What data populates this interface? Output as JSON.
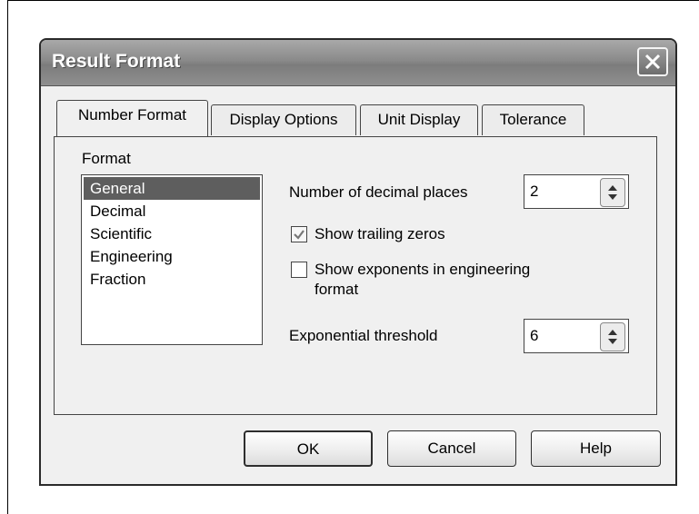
{
  "dialog": {
    "title": "Result Format",
    "close_icon": "close-icon"
  },
  "tabs": [
    {
      "label": "Number Format",
      "active": true
    },
    {
      "label": "Display Options",
      "active": false
    },
    {
      "label": "Unit Display",
      "active": false
    },
    {
      "label": "Tolerance",
      "active": false
    }
  ],
  "format": {
    "label": "Format",
    "items": [
      "General",
      "Decimal",
      "Scientific",
      "Engineering",
      "Fraction"
    ],
    "selected": "General"
  },
  "decimal_places": {
    "label": "Number of decimal places",
    "value": "2"
  },
  "show_trailing_zeros": {
    "label": "Show trailing zeros",
    "checked": true
  },
  "show_exponents": {
    "label_line1": "Show exponents in engineering",
    "label_line2": "format",
    "checked": false
  },
  "exponential_threshold": {
    "label": "Exponential threshold",
    "value": "6"
  },
  "buttons": {
    "ok": "OK",
    "cancel": "Cancel",
    "help": "Help"
  },
  "colors": {
    "title_bar": "#8a8a8a",
    "selected_item": "#5e5e5e",
    "dialog_bg": "#f0f0f0"
  }
}
